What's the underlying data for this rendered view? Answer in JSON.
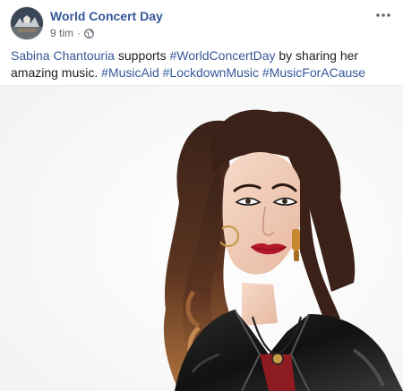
{
  "post": {
    "page_name": "World Concert Day",
    "time": "9 tim",
    "separator": "·",
    "privacy_icon": "globe-icon",
    "more_icon": "more-options-icon",
    "text": {
      "mention": "Sabina Chantouria",
      "middle": " supports ",
      "hashtag1": "#WorldConcertDay",
      "after_hashtag1": " by sharing her amazing music. ",
      "hashtag2": "#MusicAid",
      "hashtag3": "#LockdownMusic",
      "hashtag4": "#MusicForACause",
      "space": " "
    },
    "photo": {
      "icon": "post-photo"
    }
  },
  "colors": {
    "link": "#365899",
    "meta": "#616770",
    "text": "#1c1e21",
    "background": "#ffffff"
  }
}
